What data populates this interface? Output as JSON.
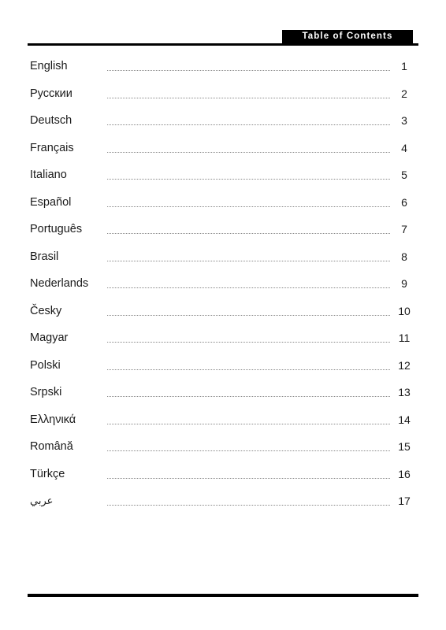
{
  "header": {
    "badge_title": "Table of Contents"
  },
  "toc": {
    "entries": [
      {
        "label": "English",
        "page": "1"
      },
      {
        "label": "Русскии",
        "page": "2"
      },
      {
        "label": "Deutsch",
        "page": "3"
      },
      {
        "label": "Français",
        "page": "4"
      },
      {
        "label": "Italiano",
        "page": "5"
      },
      {
        "label": "Español",
        "page": "6"
      },
      {
        "label": "Português",
        "page": "7"
      },
      {
        "label": "Brasil",
        "page": "8"
      },
      {
        "label": "Nederlands",
        "page": "9"
      },
      {
        "label": "Česky",
        "page": "10"
      },
      {
        "label": "Magyar",
        "page": "11"
      },
      {
        "label": "Polski",
        "page": "12"
      },
      {
        "label": "Srpski",
        "page": "13"
      },
      {
        "label": "Ελληνικά",
        "page": "14"
      },
      {
        "label": "Română",
        "page": "15"
      },
      {
        "label": "Türkçe",
        "page": "16"
      },
      {
        "label": "عربي",
        "page": "17"
      }
    ]
  },
  "colors": {
    "ink": "#000000",
    "paper": "#ffffff",
    "leader": "#8a8a8a"
  }
}
